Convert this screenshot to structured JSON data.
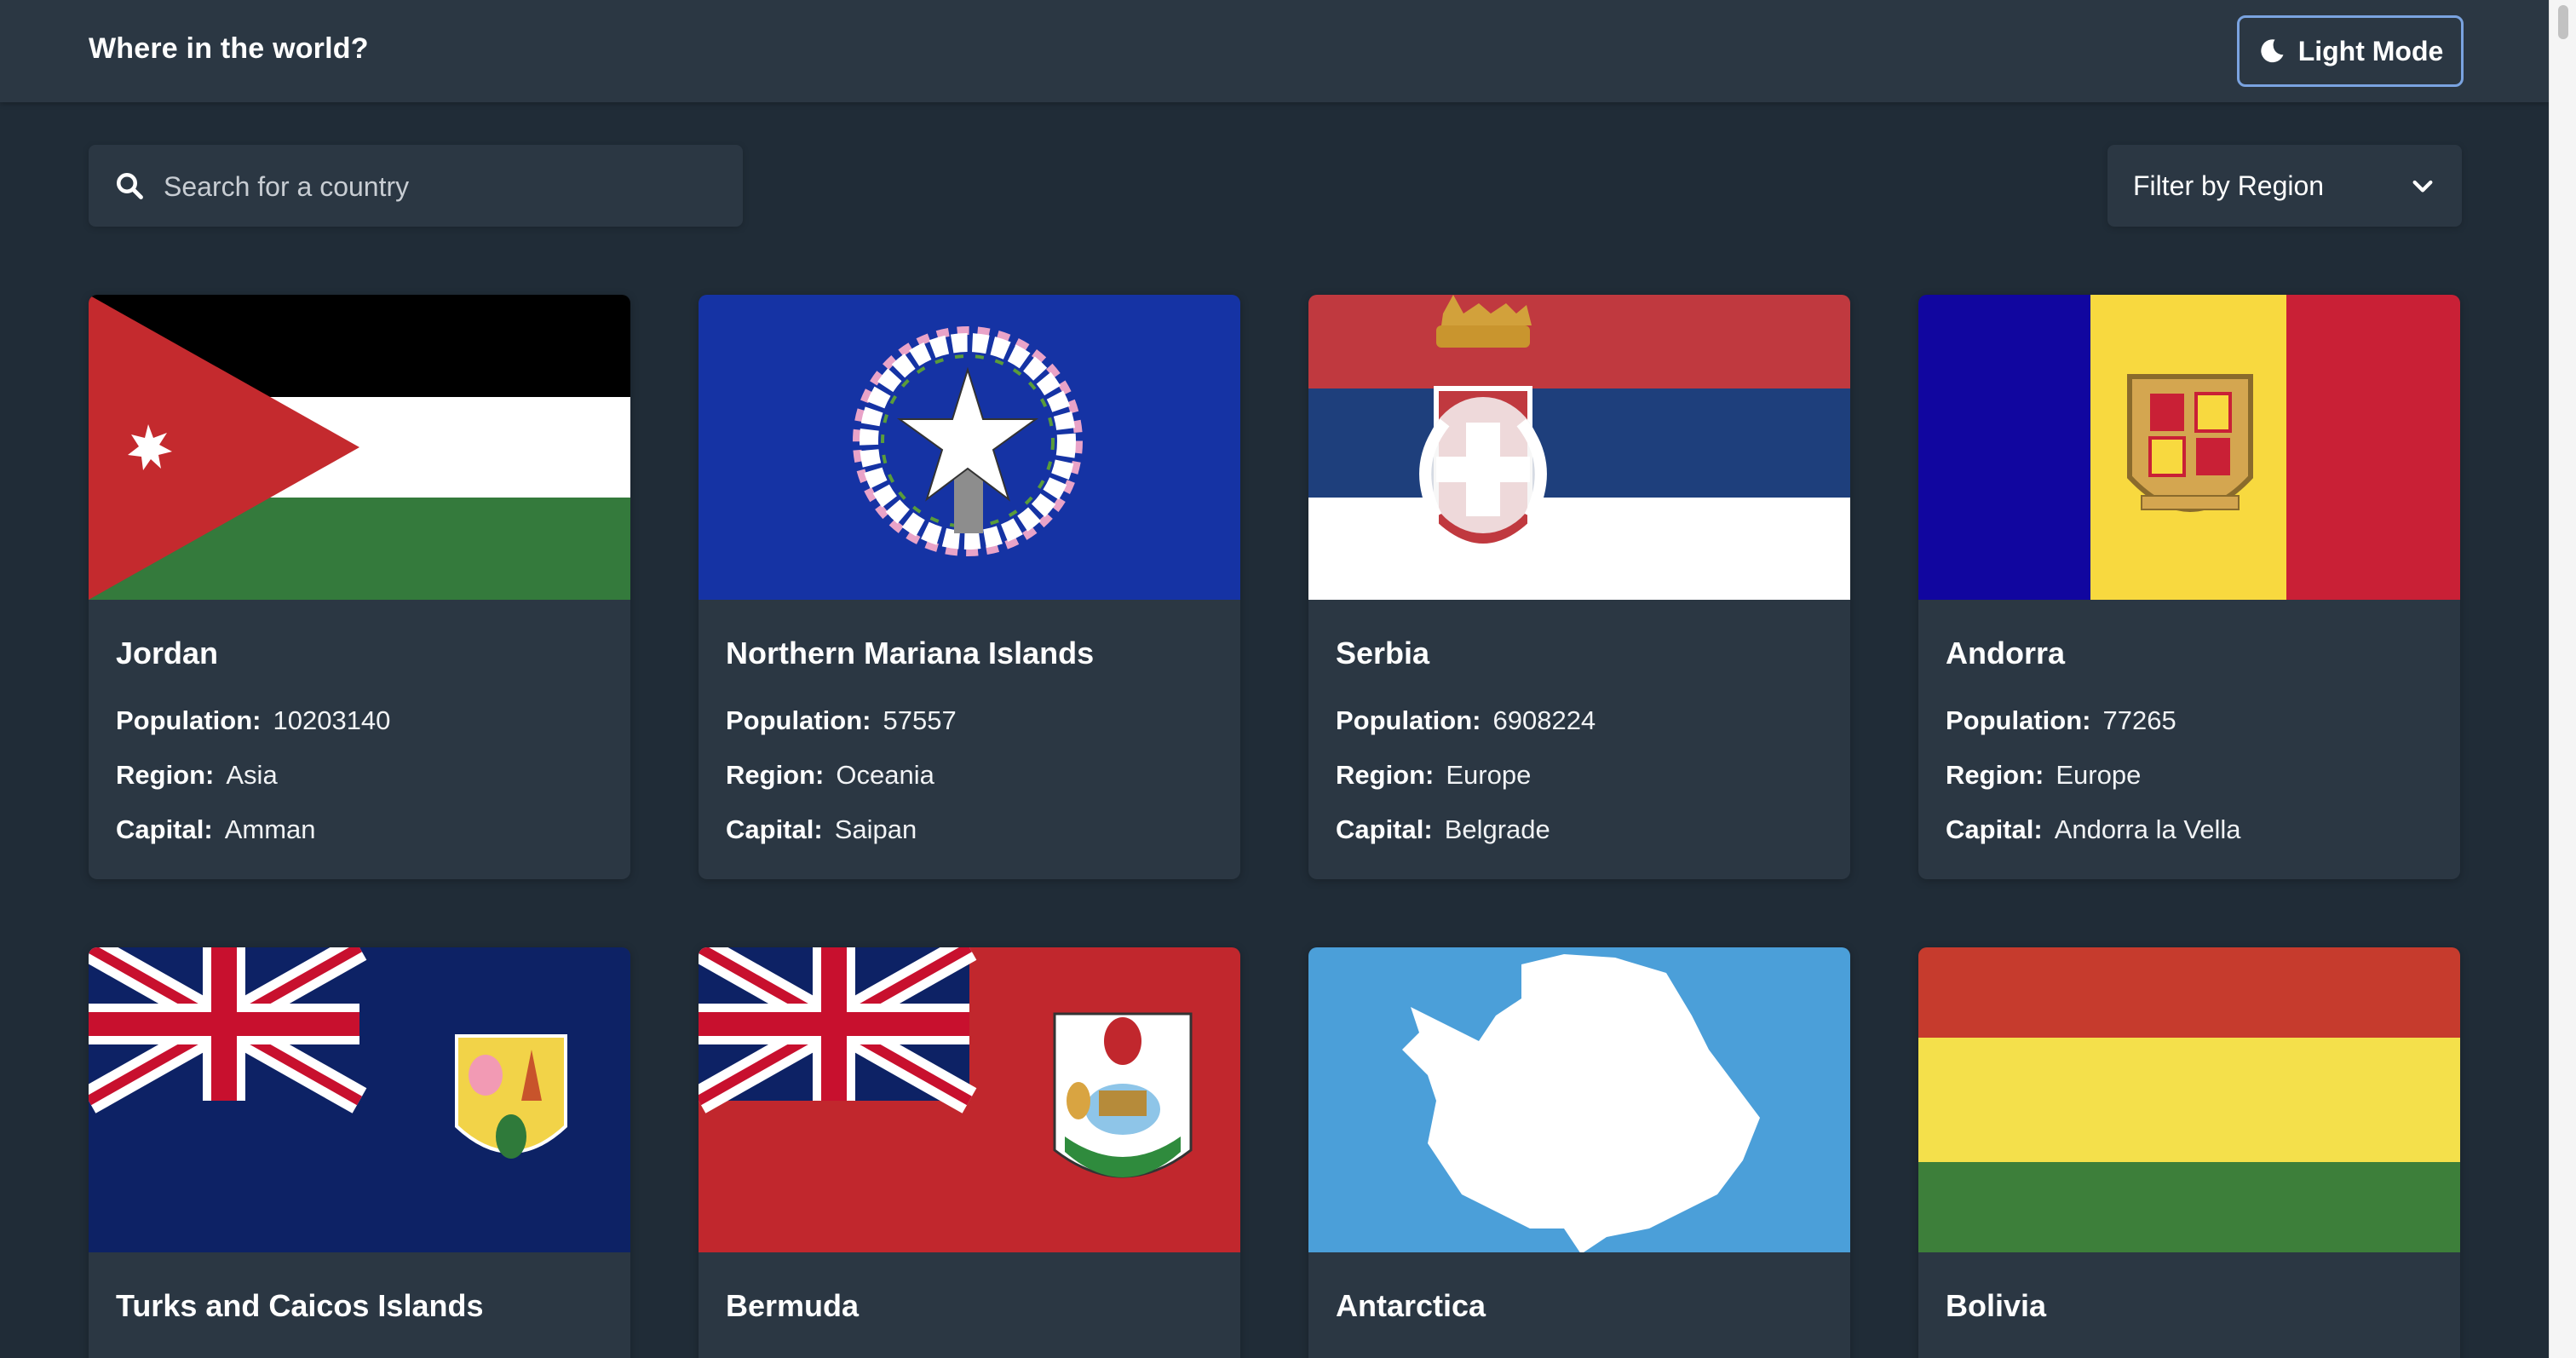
{
  "header": {
    "title": "Where in the world?",
    "mode_label": "Light Mode"
  },
  "search": {
    "placeholder": "Search for a country",
    "value": ""
  },
  "filter": {
    "label": "Filter by Region"
  },
  "labels": {
    "population": "Population:",
    "region": "Region:",
    "capital": "Capital:"
  },
  "countries": [
    {
      "name": "Jordan",
      "population": "10203140",
      "region": "Asia",
      "capital": "Amman"
    },
    {
      "name": "Northern Mariana Islands",
      "population": "57557",
      "region": "Oceania",
      "capital": "Saipan"
    },
    {
      "name": "Serbia",
      "population": "6908224",
      "region": "Europe",
      "capital": "Belgrade"
    },
    {
      "name": "Andorra",
      "population": "77265",
      "region": "Europe",
      "capital": "Andorra la Vella"
    },
    {
      "name": "Turks and Caicos Islands"
    },
    {
      "name": "Bermuda"
    },
    {
      "name": "Antarctica"
    },
    {
      "name": "Bolivia"
    }
  ],
  "theme": {
    "background": "#202c37",
    "elements": "#2b3743",
    "text": "#ffffff",
    "mode_button_border": "#7aa3e0"
  },
  "icons": {
    "mode": "moon-icon",
    "search": "search-icon",
    "filter": "chevron-down-icon"
  }
}
